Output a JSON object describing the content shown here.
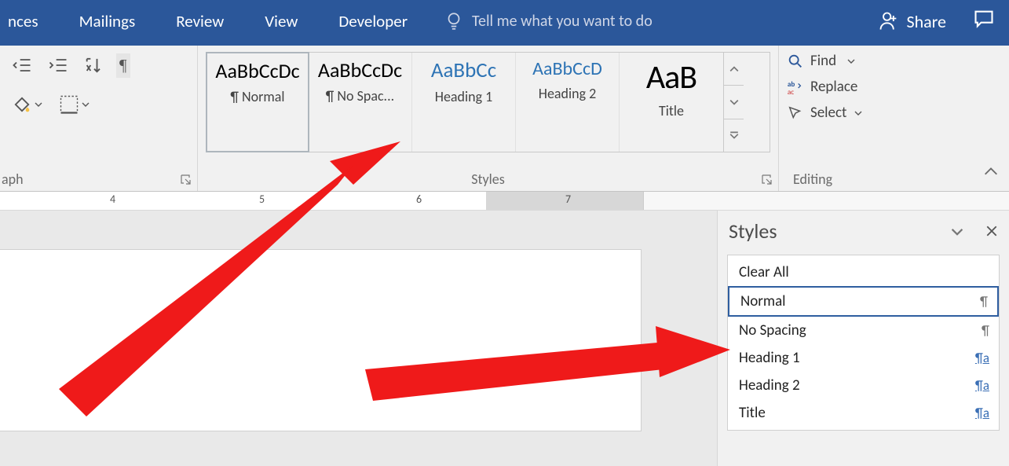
{
  "tabs": {
    "references": "nces",
    "mailings": "Mailings",
    "review": "Review",
    "view": "View",
    "developer": "Developer"
  },
  "tellme_placeholder": "Tell me what you want to do",
  "share_label": "Share",
  "groups": {
    "paragraph_label": "aph",
    "styles_label": "Styles",
    "editing_label": "Editing"
  },
  "gallery": {
    "items": [
      {
        "sample": "AaBbCcDc",
        "label": "¶ Normal",
        "cls": ""
      },
      {
        "sample": "AaBbCcDc",
        "label": "¶ No Spac...",
        "cls": ""
      },
      {
        "sample": "AaBbCc",
        "label": "Heading 1",
        "cls": "h1"
      },
      {
        "sample": "AaBbCcD",
        "label": "Heading 2",
        "cls": "h2"
      },
      {
        "sample": "AaB",
        "label": "Title",
        "cls": "title"
      }
    ]
  },
  "editing": {
    "find": "Find",
    "replace": "Replace",
    "select": "Select"
  },
  "ruler": {
    "n4": "4",
    "n5": "5",
    "n6": "6",
    "n7": "7"
  },
  "styles_pane": {
    "title": "Styles",
    "items": [
      {
        "label": "Clear All",
        "sym": "",
        "link": false
      },
      {
        "label": "Normal",
        "sym": "¶",
        "link": false,
        "selected": true
      },
      {
        "label": "No Spacing",
        "sym": "¶",
        "link": false
      },
      {
        "label": "Heading 1",
        "sym": "¶a",
        "link": true
      },
      {
        "label": "Heading 2",
        "sym": "¶a",
        "link": true
      },
      {
        "label": "Title",
        "sym": "¶a",
        "link": true
      }
    ]
  }
}
